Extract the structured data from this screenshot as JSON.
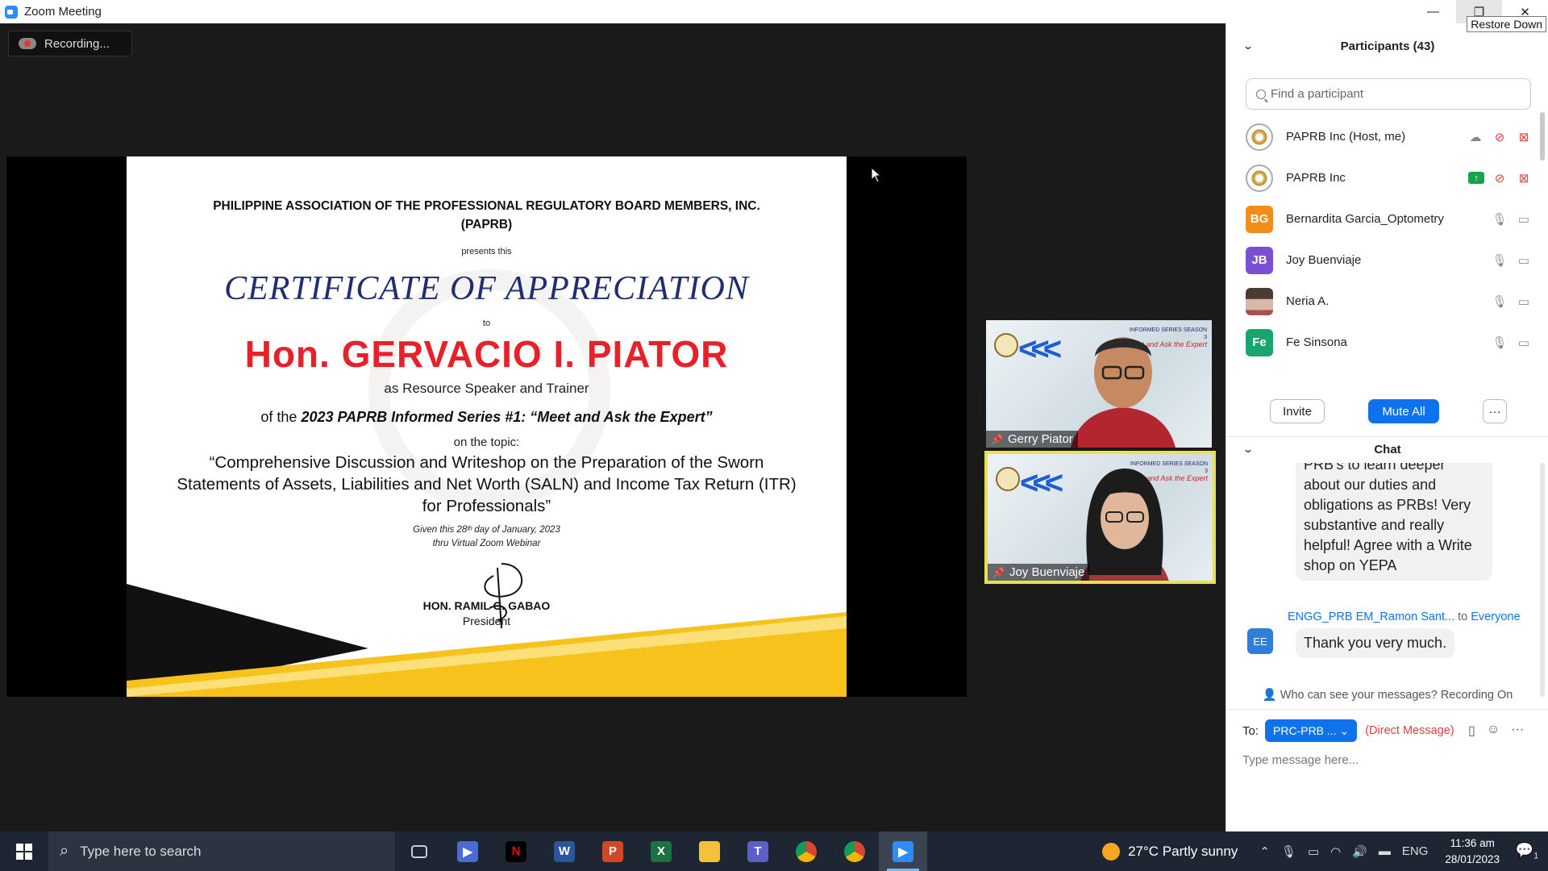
{
  "window": {
    "title": "Zoom Meeting",
    "tooltip": "Restore Down"
  },
  "recording": {
    "label": "Recording..."
  },
  "certificate": {
    "org_line1": "PHILIPPINE ASSOCIATION OF THE  PROFESSIONAL REGULATORY BOARD MEMBERS, INC.",
    "org_line2": "(PAPRB)",
    "presents": "presents  this",
    "title": "CERTIFICATE OF APPRECIATION",
    "to": "to",
    "name": "Hon. GERVACIO I. PIATOR",
    "role": "as Resource Speaker and Trainer",
    "of_the": "of the ",
    "series": "2023 PAPRB Informed Series #1: “Meet and Ask the Expert”",
    "on_topic": "on the topic:",
    "topic_line1": "“Comprehensive Discussion and Writeshop on the Preparation of the Sworn",
    "topic_line2": "Statements of Assets, Liabilities and Net Worth (SALN) and Income Tax Return (ITR)",
    "topic_line3": "for Professionals”",
    "given_line1": "Given this 28ᵗʰ day of January, 2023",
    "given_line2": "thru Virtual Zoom Webinar",
    "signer_name": "HON. RAMIL G. GABAO",
    "signer_title": "President"
  },
  "video_tiles": [
    {
      "name": "Gerry Piator",
      "banner": "INFORMED SERIES SEASON 3",
      "banner2": "Meet and Ask the Expert"
    },
    {
      "name": "Joy Buenviaje",
      "banner": "INFORMED SERIES SEASON 3",
      "banner2": "Meet and Ask the Expert"
    }
  ],
  "participants": {
    "header": "Participants (43)",
    "search_placeholder": "Find a participant",
    "list": [
      {
        "name": "PAPRB Inc (Host, me)",
        "avatar": "",
        "avatar_type": "logo",
        "icon1": "recording-cloud-icon",
        "mic": "muted",
        "video": "off"
      },
      {
        "name": "PAPRB Inc",
        "avatar": "",
        "avatar_type": "logo",
        "icon1": "share-screen-icon",
        "mic": "muted",
        "video": "off"
      },
      {
        "name": "Bernardita Garcia_Optometry",
        "avatar": "BG",
        "avatar_color": "#f28c1c",
        "mic": "on",
        "video": "on"
      },
      {
        "name": "Joy Buenviaje",
        "avatar": "JB",
        "avatar_color": "#7b4fd4",
        "mic": "on",
        "video": "on"
      },
      {
        "name": "Neria A.",
        "avatar": "",
        "avatar_type": "photo",
        "mic": "on",
        "video": "on"
      },
      {
        "name": "Fe Sinsona",
        "avatar": "Fe",
        "avatar_color": "#17a66e",
        "mic": "on",
        "video": "on"
      }
    ],
    "invite_label": "Invite",
    "mute_all_label": "Mute All",
    "more_label": "···"
  },
  "chat": {
    "header": "Chat",
    "prev_message": "PRB's to learn deeper about our duties and obligations as PRBs! Very substantive and really helpful! Agree with a Write shop on YEPA",
    "sender": "ENGG_PRB EM_Ramon Sant...",
    "to_word": "to",
    "everyone": "Everyone",
    "sender_avatar": "EE",
    "message": "Thank you very much.",
    "who_can_see": "Who can see your messages? Recording On",
    "to_label": "To:",
    "recipient": "PRC-PRB ...",
    "direct_message": "(Direct Message)",
    "input_placeholder": "Type message here..."
  },
  "taskbar": {
    "search_placeholder": "Type here to search",
    "apps": [
      "task-view",
      "zoom",
      "netflix",
      "word",
      "powerpoint",
      "excel",
      "file-explorer",
      "teams",
      "chrome",
      "chrome-profile",
      "zoom-active"
    ],
    "weather": "27°C  Partly sunny",
    "language": "ENG",
    "time": "11:36 am",
    "date": "28/01/2023",
    "notification_count": "1"
  },
  "colors": {
    "accent": "#0e72ed",
    "name_red": "#e8202a",
    "cert_title": "#1e2e6e",
    "speaker_border": "#e9e24f"
  }
}
